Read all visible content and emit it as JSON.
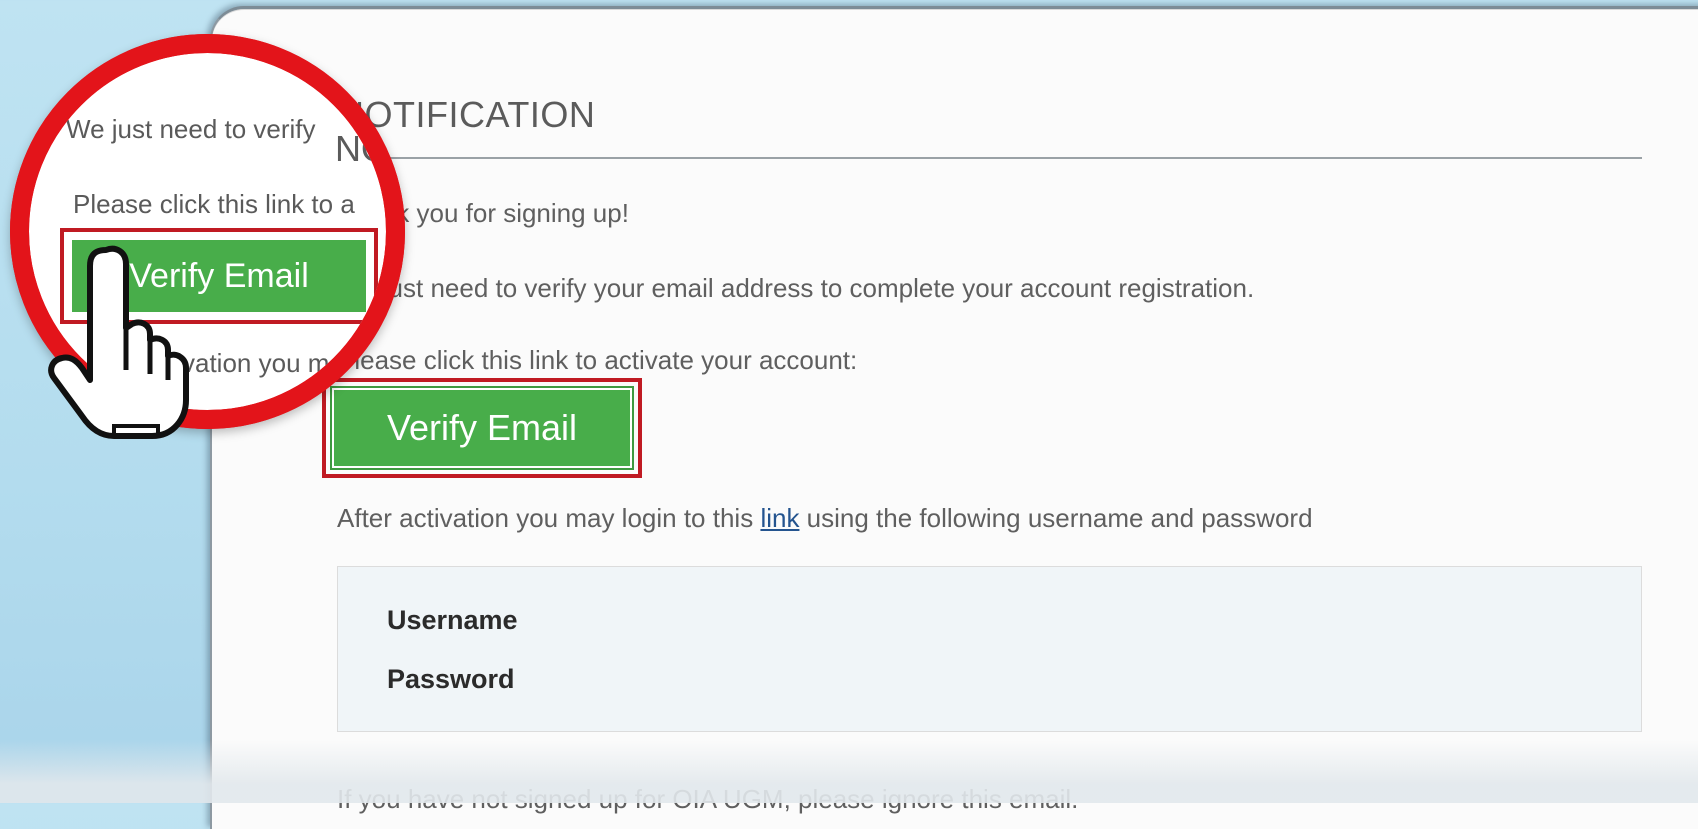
{
  "email": {
    "heading": "NOTIFICATION",
    "greeting": "Thank you for signing up!",
    "verify_text": "We just need to verify your email address to complete your account registration.",
    "click_text": "Please click this link to activate your account:",
    "verify_button": "Verify Email",
    "after_text_before": "After activation you may login to this ",
    "link_label": "link",
    "after_text_after": " using the following username and password",
    "credentials": {
      "username_label": "Username",
      "password_label": "Password"
    },
    "footer_text": "If you have not signed up for OIA UGM, please ignore this email."
  },
  "magnifier": {
    "line1": "We just need to verify",
    "line2": "Please click this link to a",
    "line3": "ctivation you ma",
    "heading_fragment": "NOTIFICATION",
    "button": "Verify Email"
  },
  "colors": {
    "accent_green": "#48ad4a",
    "highlight_red": "#c01a23",
    "magnifier_ring": "#e3141a",
    "link_blue": "#24548f"
  },
  "icons": [
    "hand-pointer-icon"
  ]
}
